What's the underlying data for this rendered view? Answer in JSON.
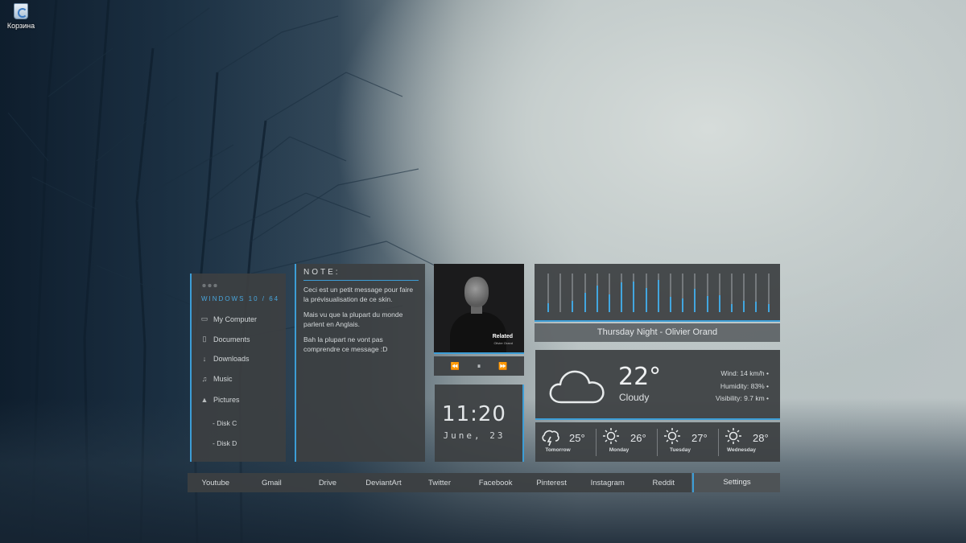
{
  "desktop": {
    "recycle_bin_label": "Корзина"
  },
  "sidebar": {
    "os_name": "WINDOWS 10 / 64",
    "items": [
      {
        "label": "My Computer",
        "icon": "monitor-icon"
      },
      {
        "label": "Documents",
        "icon": "document-icon"
      },
      {
        "label": "Downloads",
        "icon": "download-icon"
      },
      {
        "label": "Music",
        "icon": "music-note-icon"
      },
      {
        "label": "Pictures",
        "icon": "picture-icon"
      }
    ],
    "disks": [
      "- Disk C",
      "- Disk D"
    ]
  },
  "note": {
    "title": "NOTE:",
    "paragraphs": [
      "Ceci est un petit message pour faire la prévisualisation de ce skin.",
      "Mais vu que la plupart du monde parlent en Anglais.",
      "Bah la plupart ne vont pas comprendre ce message :D"
    ]
  },
  "music": {
    "album_title": "Related",
    "album_artist": "Olivier Orand",
    "controls": {
      "prev": "⏪",
      "pause": "⏸",
      "next": "⏩"
    },
    "now_playing": "Thursday Night - Olivier Orand",
    "levels": [
      0.22,
      0.0,
      0.3,
      0.5,
      0.68,
      0.45,
      0.78,
      0.8,
      0.62,
      0.84,
      0.4,
      0.35,
      0.6,
      0.42,
      0.44,
      0.2,
      0.3,
      0.28,
      0.2
    ]
  },
  "clock": {
    "time": "11:20",
    "date": "June, 23"
  },
  "weather": {
    "temperature": "22°",
    "condition": "Cloudy",
    "wind": "Wind: 14 km/h •",
    "humidity": "Humidity: 83% •",
    "visibility": "Visibility: 9.7 km •",
    "forecast": [
      {
        "day": "Tomorrow",
        "temp": "25°",
        "icon": "storm-icon"
      },
      {
        "day": "Monday",
        "temp": "26°",
        "icon": "sun-icon"
      },
      {
        "day": "Tuesday",
        "temp": "27°",
        "icon": "sun-icon"
      },
      {
        "day": "Wednesday",
        "temp": "28°",
        "icon": "sun-icon"
      }
    ]
  },
  "taskbar": {
    "links": [
      "Youtube",
      "Gmail",
      "Drive",
      "DeviantArt",
      "Twitter",
      "Facebook",
      "Pinterest",
      "Instagram",
      "Reddit"
    ],
    "settings": "Settings"
  },
  "colors": {
    "accent": "#3c9dd6",
    "panel": "#3c4042"
  }
}
